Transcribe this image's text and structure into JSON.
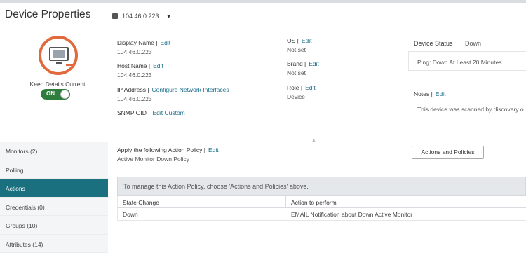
{
  "page": {
    "title": "Device Properties"
  },
  "device_select": {
    "value": "104.46.0.223"
  },
  "profile": {
    "keep_details_label": "Keep Details Current",
    "toggle_label": "ON"
  },
  "properties": {
    "display_name": {
      "label": "Display Name |",
      "edit": "Edit",
      "value": "104.46.0.223"
    },
    "host_name": {
      "label": "Host Name |",
      "edit": "Edit",
      "value": "104.46.0.223"
    },
    "ip_address": {
      "label": "IP Address |",
      "edit": "Configure Network Interfaces",
      "value": "104.46.0.223"
    },
    "snmp_oid": {
      "label": "SNMP OID |",
      "edit": "Edit Custom"
    },
    "os": {
      "label": "OS |",
      "edit": "Edit",
      "value": "Not set"
    },
    "brand": {
      "label": "Brand |",
      "edit": "Edit",
      "value": "Not set"
    },
    "role": {
      "label": "Role |",
      "edit": "Edit",
      "value": "Device"
    }
  },
  "status": {
    "label": "Device Status",
    "value": "Down",
    "message": "Ping: Down At Least 20 Minutes"
  },
  "notes": {
    "label": "Notes |",
    "edit": "Edit",
    "text": "This device was scanned by discovery o"
  },
  "sidebar": {
    "items": [
      {
        "label": "Monitors (2)"
      },
      {
        "label": "Polling"
      },
      {
        "label": "Actions"
      },
      {
        "label": "Credentials (0)"
      },
      {
        "label": "Groups (10)"
      },
      {
        "label": "Attributes (14)"
      }
    ]
  },
  "action_policy": {
    "label": "Apply the following Action Policy |",
    "edit": "Edit",
    "value": "Active Monitor Down Policy",
    "button": "Actions and Policies",
    "banner": "To manage this Action Policy, choose 'Actions and Policies' above."
  },
  "table": {
    "headers": [
      "State Change",
      "Action to perform"
    ],
    "rows": [
      [
        "Down",
        "EMAIL Notification about Down Active Monitor"
      ]
    ]
  }
}
